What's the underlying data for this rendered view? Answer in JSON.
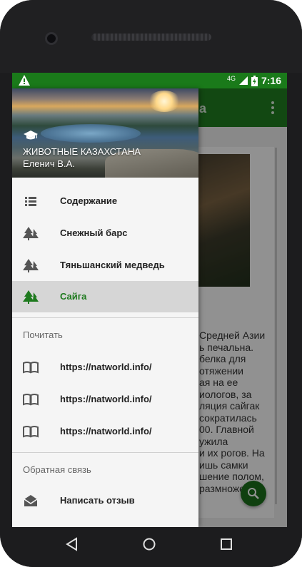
{
  "status_bar": {
    "warning_icon": "warning-triangle-icon",
    "network": "4G",
    "time": "7:16"
  },
  "background_app": {
    "title_fragment": "а",
    "article_lines": [
      "Средней Азии",
      "ь печальна.",
      "белка для",
      "отяжении",
      "ая на ее",
      "иологов, за",
      "ляция сайгак",
      "сократилась",
      "00. Главной",
      "ужила",
      "и их рогов. На",
      "ишь самки",
      "шение полом,",
      "размножения"
    ],
    "fab_icon": "search-icon"
  },
  "drawer": {
    "header_icon": "graduation-cap-icon",
    "header_title": "ЖИВОТНЫЕ КАЗАХСТАНА",
    "header_subtitle": "Еленич В.А.",
    "items": [
      {
        "label": "Содержание",
        "icon": "list-icon",
        "active": false
      },
      {
        "label": "Снежный барс",
        "icon": "tree-icon",
        "active": false
      },
      {
        "label": "Тяньшанский медведь",
        "icon": "tree-icon",
        "active": false
      },
      {
        "label": "Сайга",
        "icon": "tree-icon",
        "active": true
      }
    ],
    "read_section": {
      "title": "Почитать",
      "links": [
        {
          "label": "https://natworld.info/",
          "icon": "book-icon"
        },
        {
          "label": "https://natworld.info/",
          "icon": "book-icon"
        },
        {
          "label": "https://natworld.info/",
          "icon": "book-icon"
        }
      ]
    },
    "feedback_section": {
      "title": "Обратная связь",
      "items": [
        {
          "label": "Написать отзыв",
          "icon": "envelope-open-icon"
        }
      ]
    }
  },
  "nav_bar": {
    "back": "back-triangle-icon",
    "home": "home-circle-icon",
    "recents": "recents-square-icon"
  },
  "colors": {
    "primary": "#1f7d1f",
    "status_bar": "#1a7a1a",
    "active_text": "#1e7a1e"
  }
}
